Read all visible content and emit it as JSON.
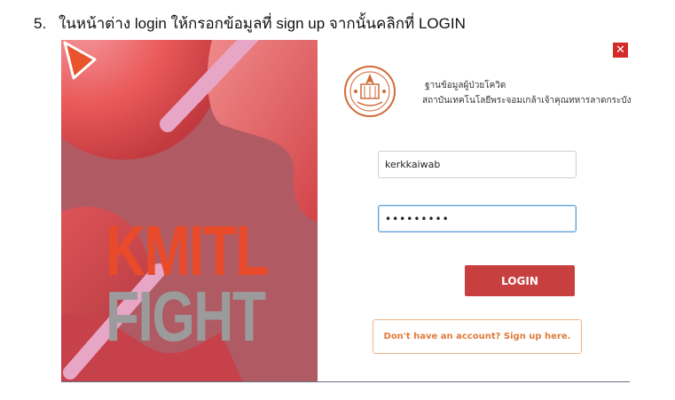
{
  "instruction": {
    "step_number": "5.",
    "text": "ในหน้าต่าง login ให้กรอกข้อมูลที่ sign up จากนั้นคลิกที่ LOGIN"
  },
  "window": {
    "close_symbol": "✕",
    "art": {
      "line1": "KMITL",
      "line2": "FIGHT"
    },
    "org": {
      "line1": "ฐานข้อมูลผู้ป่วยโควิด",
      "line2": "สถาบันเทคโนโลยีพระจอมเกล้าเจ้าคุณทหารลาดกระบัง"
    },
    "username": {
      "value": "kerkkaiwab"
    },
    "password": {
      "value": "•••••••••"
    },
    "login_label": "LOGIN",
    "signup_label": "Don't have an account? Sign up here."
  },
  "colors": {
    "accent": "#c7403f",
    "signup_text": "#e07a3a",
    "art_background": "#b05a64"
  },
  "icons": [
    "close-icon",
    "university-seal-logo",
    "play-icon"
  ]
}
